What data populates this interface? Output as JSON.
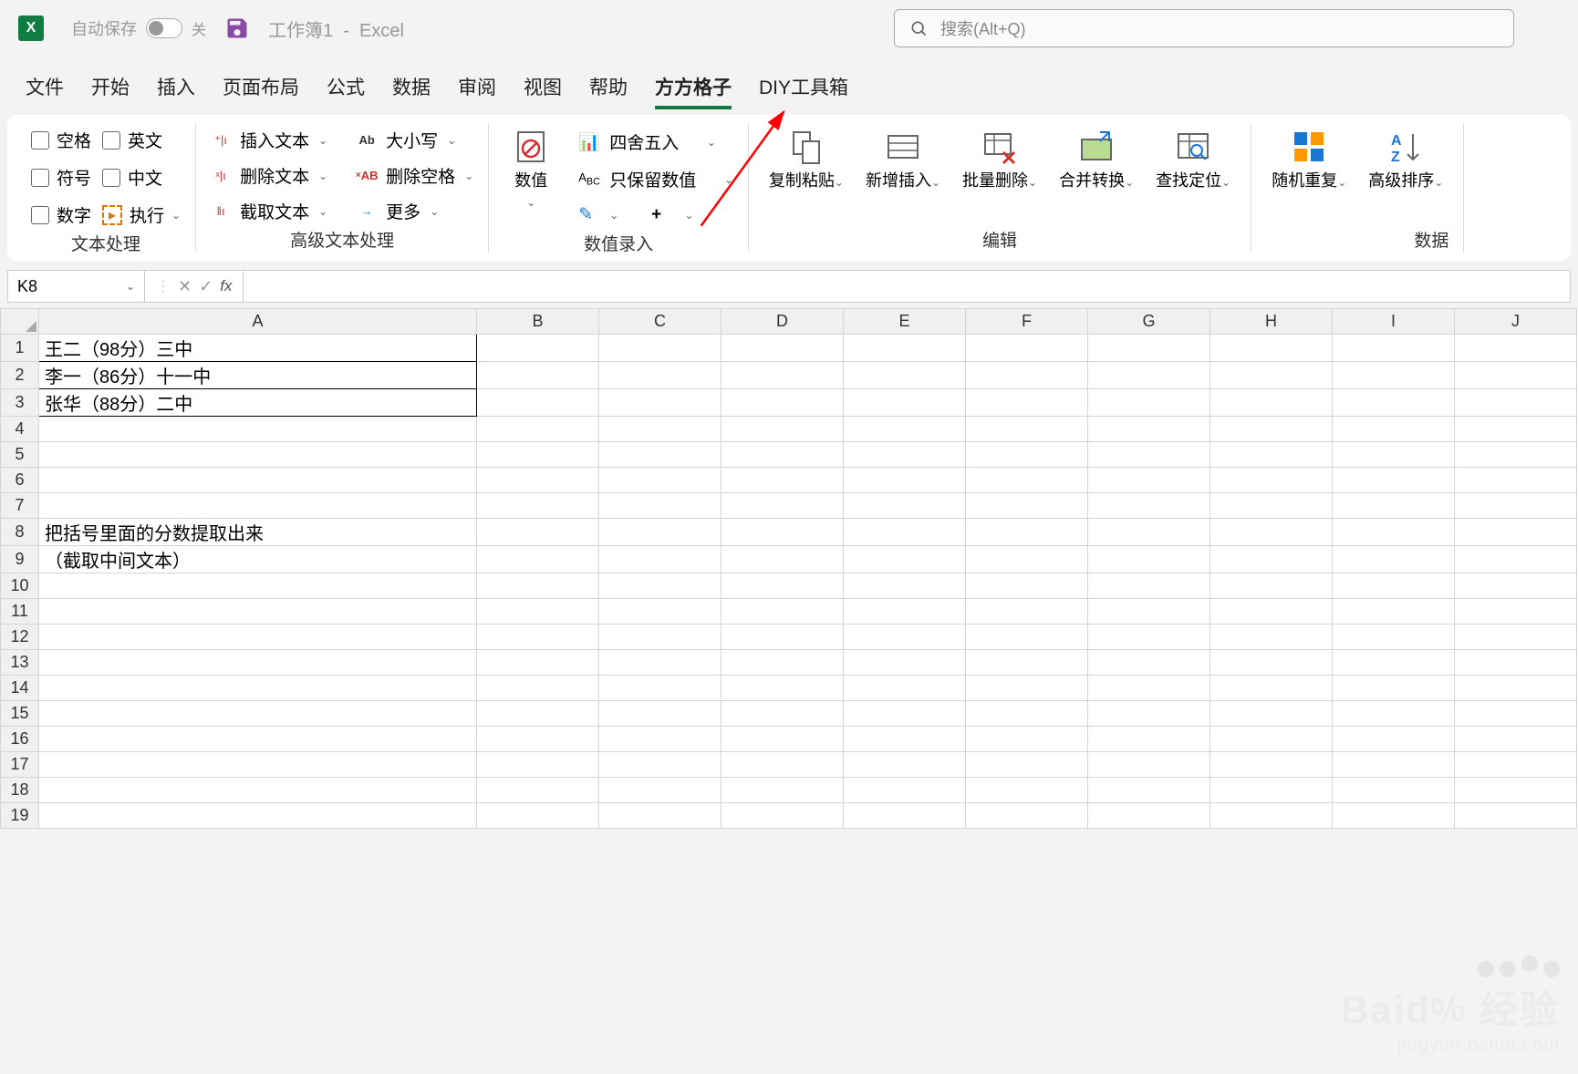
{
  "title_bar": {
    "autosave_label": "自动保存",
    "autosave_state": "关",
    "doc_name": "工作簿1",
    "app_name": "Excel",
    "search_placeholder": "搜索(Alt+Q)"
  },
  "tabs": [
    "文件",
    "开始",
    "插入",
    "页面布局",
    "公式",
    "数据",
    "审阅",
    "视图",
    "帮助",
    "方方格子",
    "DIY工具箱"
  ],
  "active_tab": "方方格子",
  "ribbon": {
    "group1": {
      "label": "文本处理",
      "checks": [
        "空格",
        "英文",
        "符号",
        "中文",
        "数字",
        "执行"
      ]
    },
    "group2": {
      "label": "高级文本处理",
      "cmds1": [
        "插入文本",
        "删除文本",
        "截取文本"
      ],
      "cmds2_case": "大小写",
      "cmds2_del": "删除空格",
      "cmds2_more": "更多"
    },
    "group3": {
      "label": "数值录入",
      "numval": "数值",
      "round": "四舍五入",
      "keepnum": "只保留数值"
    },
    "group4": {
      "label": "编辑",
      "copy": "复制粘贴",
      "insert": "新增插入",
      "delete": "批量删除",
      "merge": "合并转换",
      "find": "查找定位"
    },
    "group5": {
      "label": "数据",
      "random": "随机重复",
      "sort": "高级排序"
    }
  },
  "formula_bar": {
    "name_box": "K8",
    "formula": ""
  },
  "sheet": {
    "cols": [
      "A",
      "B",
      "C",
      "D",
      "E",
      "F",
      "G",
      "H",
      "I",
      "J"
    ],
    "rows": [
      {
        "n": 1,
        "A": "王二（98分）三中"
      },
      {
        "n": 2,
        "A": "李一（86分）十一中"
      },
      {
        "n": 3,
        "A": "张华（88分）二中"
      },
      {
        "n": 4,
        "A": ""
      },
      {
        "n": 5,
        "A": ""
      },
      {
        "n": 6,
        "A": ""
      },
      {
        "n": 7,
        "A": ""
      },
      {
        "n": 8,
        "A": "把括号里面的分数提取出来"
      },
      {
        "n": 9,
        "A": "（截取中间文本）"
      },
      {
        "n": 10,
        "A": ""
      },
      {
        "n": 11,
        "A": ""
      },
      {
        "n": 12,
        "A": ""
      },
      {
        "n": 13,
        "A": ""
      },
      {
        "n": 14,
        "A": ""
      },
      {
        "n": 15,
        "A": ""
      },
      {
        "n": 16,
        "A": ""
      },
      {
        "n": 17,
        "A": ""
      },
      {
        "n": 18,
        "A": ""
      },
      {
        "n": 19,
        "A": ""
      }
    ]
  },
  "watermark": {
    "main": "Baid",
    "main2": "经验",
    "sub": "jingyan.baidu.com"
  }
}
